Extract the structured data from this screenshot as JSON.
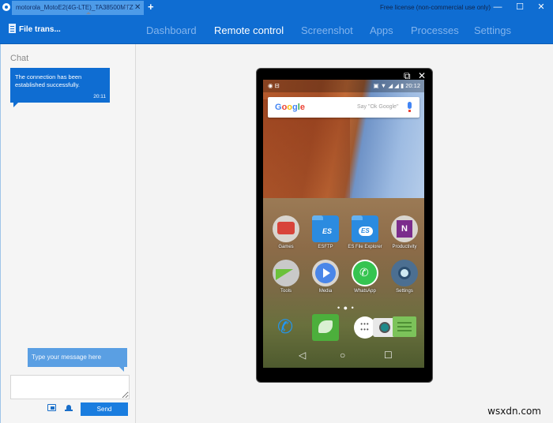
{
  "titlebar": {
    "tab_label": "motorola_MotoE2(4G-LTE)_TA38500MTZ",
    "tab_star": "☆",
    "tab_close": "✕",
    "new_tab": "+",
    "license": "Free license (non-commercial use only)",
    "minimize": "—",
    "maximize": "☐",
    "close": "✕"
  },
  "navbar": {
    "file_transfer": "File trans...",
    "items": [
      {
        "label": "Dashboard",
        "active": false
      },
      {
        "label": "Remote control",
        "active": true
      },
      {
        "label": "Screenshot",
        "active": false
      },
      {
        "label": "Apps",
        "active": false
      },
      {
        "label": "Processes",
        "active": false
      },
      {
        "label": "Settings",
        "active": false
      }
    ]
  },
  "chat": {
    "title": "Chat",
    "messages": [
      {
        "text": "The connection has been established successfully.",
        "time": "20:11"
      }
    ],
    "hint": "Type your message here",
    "input_value": "",
    "send_label": "Send"
  },
  "phone": {
    "popout": "⧉",
    "close": "✕",
    "status_left": "◉ ⊟",
    "status_right": "▣ ▼ ◢ ◢ ▮ 20:12",
    "time": "20:12",
    "google_logo": [
      "G",
      "o",
      "o",
      "g",
      "l",
      "e"
    ],
    "google_hint": "Say \"Ok Google\"",
    "apps": [
      {
        "label": "Games",
        "icon": "games-folder-icon",
        "color": "#d9d5cf"
      },
      {
        "label": "ESFTP",
        "icon": "esftp-icon",
        "color": "#2b8be0"
      },
      {
        "label": "ES File Explorer",
        "icon": "es-file-explorer-icon",
        "color": "#2b8be0"
      },
      {
        "label": "Productivity",
        "icon": "productivity-folder-icon",
        "color": "#d9d5cf"
      },
      {
        "label": "Tools",
        "icon": "tools-folder-icon",
        "color": "#c9c9c9"
      },
      {
        "label": "Media",
        "icon": "media-folder-icon",
        "color": "#d9d5cf"
      },
      {
        "label": "WhatsApp",
        "icon": "whatsapp-icon",
        "color": "#35c450"
      },
      {
        "label": "Settings",
        "icon": "settings-icon",
        "color": "#4c6f91"
      }
    ],
    "page_dots": "• ● •",
    "dock": [
      {
        "icon": "phone-dialer-icon",
        "color": "#2196f3"
      },
      {
        "icon": "dolphin-browser-icon",
        "color": "#4caf3c"
      },
      {
        "icon": "app-drawer-icon",
        "color": "#ffffff"
      },
      {
        "icon": "camera-icon",
        "color": "#e8e8e8"
      },
      {
        "icon": "messaging-icon",
        "color": "#7cc35a"
      }
    ],
    "nav": {
      "back": "◁",
      "home": "○",
      "recents": "☐"
    }
  },
  "watermark": "wsxdn.com",
  "colors": {
    "accent": "#0f6dd2",
    "tab_active": "#4d9be8",
    "send_button": "#1a7ddf",
    "hint_bubble": "#5a9fe3"
  }
}
